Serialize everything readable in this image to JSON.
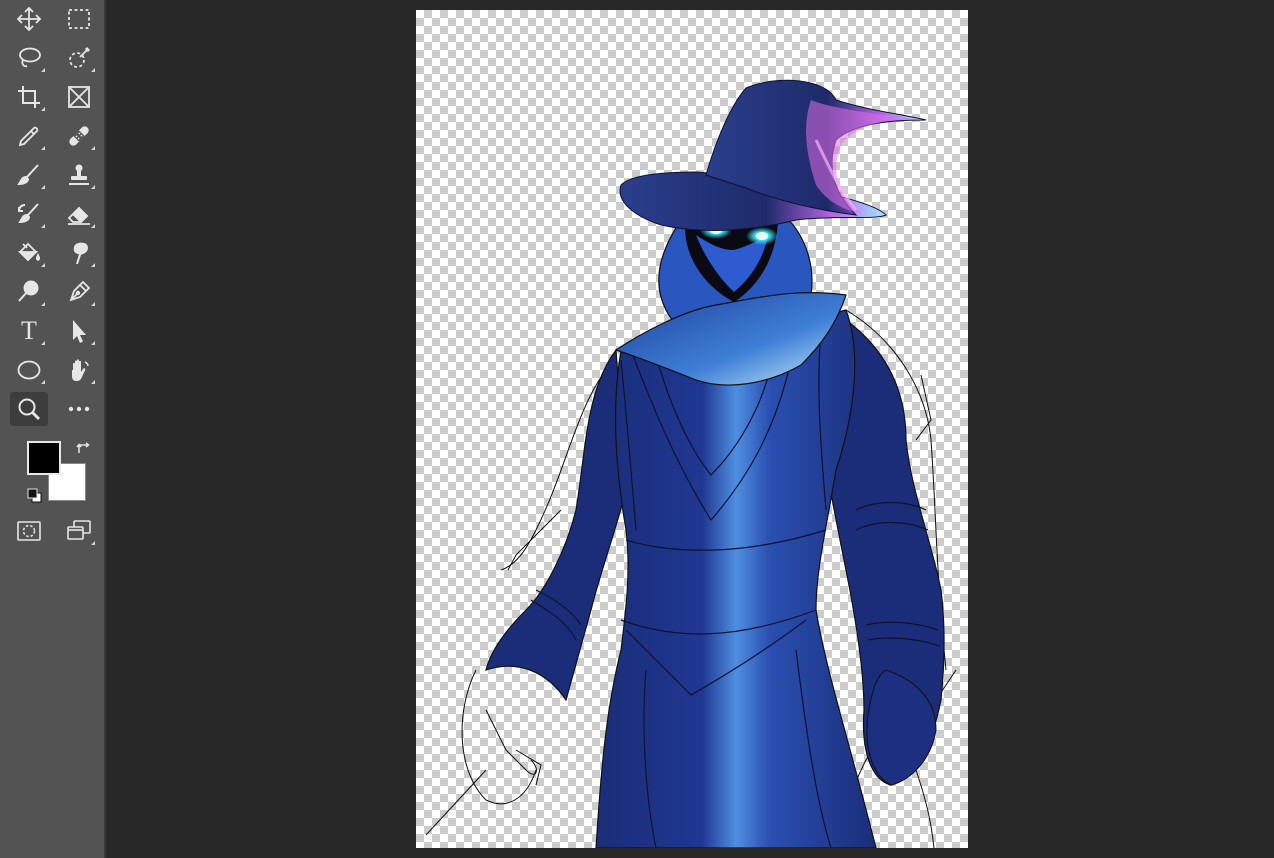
{
  "app": "Image editor",
  "toolbar": {
    "tools": [
      {
        "name": "move-tool",
        "icon": "move-icon"
      },
      {
        "name": "rectangular-marquee-tool",
        "icon": "marquee-icon"
      },
      {
        "name": "lasso-tool",
        "icon": "lasso-icon"
      },
      {
        "name": "quick-selection-tool",
        "icon": "quick-selection-icon"
      },
      {
        "name": "crop-tool",
        "icon": "crop-icon"
      },
      {
        "name": "frame-tool",
        "icon": "frame-icon"
      },
      {
        "name": "eyedropper-tool",
        "icon": "eyedropper-icon"
      },
      {
        "name": "healing-brush-tool",
        "icon": "bandage-icon"
      },
      {
        "name": "brush-tool",
        "icon": "brush-icon"
      },
      {
        "name": "clone-stamp-tool",
        "icon": "stamp-icon"
      },
      {
        "name": "history-brush-tool",
        "icon": "history-brush-icon"
      },
      {
        "name": "eraser-tool",
        "icon": "eraser-icon"
      },
      {
        "name": "paint-bucket-tool",
        "icon": "paint-bucket-icon"
      },
      {
        "name": "smudge-tool",
        "icon": "smudge-icon"
      },
      {
        "name": "dodge-tool",
        "icon": "dodge-icon"
      },
      {
        "name": "pen-tool",
        "icon": "pen-icon"
      },
      {
        "name": "type-tool",
        "icon": "type-icon",
        "label": "T"
      },
      {
        "name": "path-selection-tool",
        "icon": "arrow-icon"
      },
      {
        "name": "ellipse-tool",
        "icon": "ellipse-icon"
      },
      {
        "name": "hand-tool",
        "icon": "hand-icon"
      },
      {
        "name": "zoom-tool",
        "icon": "zoom-icon",
        "active": true
      },
      {
        "name": "edit-toolbar",
        "icon": "more-icon"
      }
    ],
    "foreground_color": "#000000",
    "background_color": "#ffffff",
    "bottom_tools": [
      {
        "name": "quick-mask-mode",
        "icon": "quick-mask-icon"
      },
      {
        "name": "screen-mode",
        "icon": "screen-mode-icon"
      }
    ]
  },
  "colors": {
    "toolbar_bg": "#535353",
    "workspace_bg": "#282828",
    "robe_dark": "#1b2d78",
    "robe_light": "#4f8fe0",
    "eye_glow": "#3ff0ff",
    "hat_highlight": "#e070e8"
  },
  "canvas": {
    "content": "wizard-illustration",
    "background": "transparent-checkerboard"
  }
}
